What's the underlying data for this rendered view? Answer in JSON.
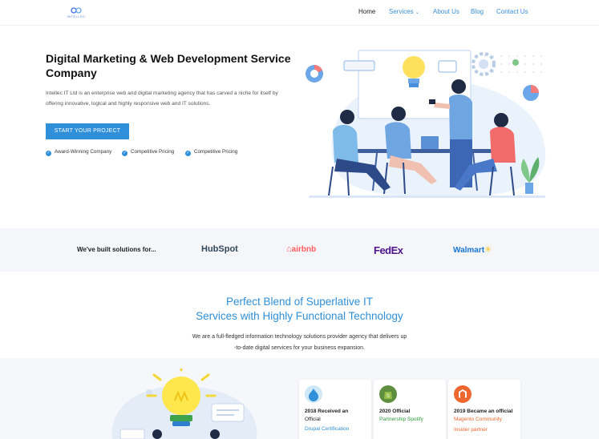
{
  "colors": {
    "accent": "#2f8fd8",
    "band": "#f4f6f9",
    "fedex_purple": "#4d148c",
    "fedex_orange": "#ff6600",
    "airbnb": "#ff5a5f",
    "walmart_blue": "#1a75cf",
    "walmart_yellow": "#ffc220"
  },
  "nav": {
    "home": "Home",
    "services": "Services",
    "about": "About Us",
    "blog": "Blog",
    "contact": "Contact Us"
  },
  "hero": {
    "title": "Digital Marketing & Web Development Service Company",
    "description": "Intellec IT Ltd is an enterprise web and digital marketing agency that has carved a niche for itself by offering innovative, logical and highly responsive web and IT solutions.",
    "cta": "START YOUR PROJECT",
    "checks": [
      "Award-Winning Company",
      "Competitive Pricing",
      "Competitive Pricing"
    ]
  },
  "clients": {
    "label": "We've built solutions for...",
    "brands": [
      "HubSpot",
      "airbnb",
      "FedEx",
      "Walmart"
    ]
  },
  "section": {
    "title_line1": "Perfect Blend of Superlative IT",
    "title_line2": "Services with Highly Functional Technology",
    "desc_line1": "We are a full-fledged information technology solutions provider agency that delivers up",
    "desc_line2": "-to-date digital services for your business expansion."
  },
  "cards": [
    {
      "l1": "2018 Received an",
      "l2": "Official",
      "l3": "Drupal Certification",
      "icon": "drupal-icon",
      "icon_color": "#cfe8f8",
      "l3_color": "#2f8fd8"
    },
    {
      "l1": "2020 Official",
      "l2": "Partnership Spotify",
      "icon": "shopify-icon",
      "icon_color": "#5e8e3e",
      "l2_color": "#2e9a3d"
    },
    {
      "l1": "2019 Became an official",
      "l2": "Magento Community",
      "l3": "Insider partner",
      "icon": "magento-icon",
      "icon_color": "#ee672f",
      "l2_color": "#ee672f",
      "l3_color": "#ee672f"
    }
  ]
}
